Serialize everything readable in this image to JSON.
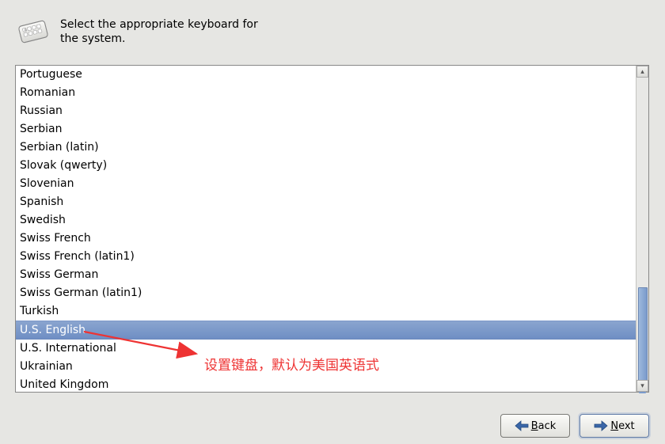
{
  "header": {
    "instruction": "Select the appropriate keyboard for the system."
  },
  "keyboard_list": {
    "items": [
      "Portuguese",
      "Romanian",
      "Russian",
      "Serbian",
      "Serbian (latin)",
      "Slovak (qwerty)",
      "Slovenian",
      "Spanish",
      "Swedish",
      "Swiss French",
      "Swiss French (latin1)",
      "Swiss German",
      "Swiss German (latin1)",
      "Turkish",
      "U.S. English",
      "U.S. International",
      "Ukrainian",
      "United Kingdom"
    ],
    "selected_index": 14
  },
  "buttons": {
    "back": "Back",
    "next": "Next"
  },
  "annotation": "设置键盘，默认为美国英语式"
}
